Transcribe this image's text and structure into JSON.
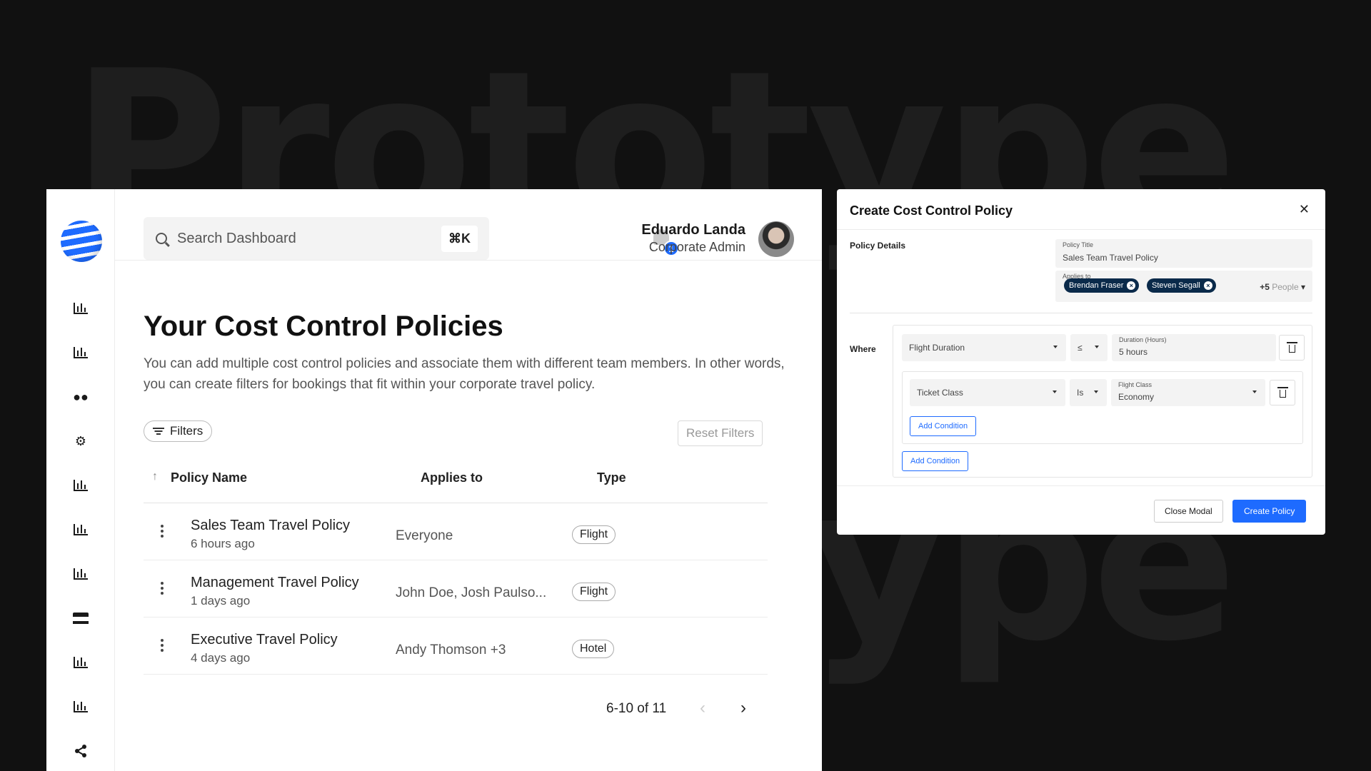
{
  "background": {
    "watermark_top": "Prototype",
    "watermark_bottom": "Prototype"
  },
  "colors": {
    "accent": "#1e6bff",
    "chip": "#0a2a4a",
    "background": "#111111"
  },
  "search": {
    "placeholder": "Search Dashboard",
    "shortcut": "⌘K"
  },
  "notifications": {
    "count": "1"
  },
  "user": {
    "name": "Eduardo Landa",
    "role": "Corporate Admin"
  },
  "sidebar": {
    "items": [
      {
        "icon": "bar-chart-icon"
      },
      {
        "icon": "bar-chart-icon"
      },
      {
        "icon": "users-icon"
      },
      {
        "icon": "gears-icon"
      },
      {
        "icon": "bar-chart-icon"
      },
      {
        "icon": "bar-chart-icon"
      },
      {
        "icon": "bar-chart-icon"
      },
      {
        "icon": "store-icon"
      },
      {
        "icon": "bar-chart-icon"
      },
      {
        "icon": "bar-chart-icon"
      },
      {
        "icon": "share-icon"
      }
    ]
  },
  "main": {
    "title": "Your Cost Control Policies",
    "description": "You can add multiple cost control policies and associate them with different team members. In other words, you can create filters for bookings that fit within your corporate travel policy.",
    "filters_label": "Filters",
    "reset_label": "Reset Filters",
    "columns": [
      "Policy Name",
      "Applies to",
      "Type"
    ],
    "rows": [
      {
        "name": "Sales Team  Travel Policy",
        "time": "6 hours ago",
        "applies": "Everyone",
        "type": "Flight"
      },
      {
        "name": "Management Travel Policy",
        "time": "1 days ago",
        "applies": "John Doe, Josh Paulso...",
        "type": "Flight"
      },
      {
        "name": "Executive Travel Policy",
        "time": "4 days ago",
        "applies": "Andy Thomson +3",
        "type": "Hotel"
      }
    ],
    "pagination": "6-10 of 11"
  },
  "modal": {
    "title": "Create Cost Control Policy",
    "section_details": "Policy Details",
    "policy_title_caption": "Policy Title",
    "policy_title_value": "Sales Team Travel Policy",
    "applies_caption": "Applies to",
    "chips": [
      "Brendan Fraser",
      "Steven Segall"
    ],
    "more_count": "+5",
    "more_label": "People",
    "section_where": "Where",
    "condition1": {
      "field": "Flight Duration",
      "operator": "≤",
      "value_caption": "Duration (Hours)",
      "value": "5 hours"
    },
    "condition2": {
      "field": "Ticket Class",
      "operator": "Is",
      "value_caption": "Flight Class",
      "value": "Economy"
    },
    "add_condition_label": "Add Condition",
    "close_label": "Close Modal",
    "create_label": "Create Policy"
  }
}
